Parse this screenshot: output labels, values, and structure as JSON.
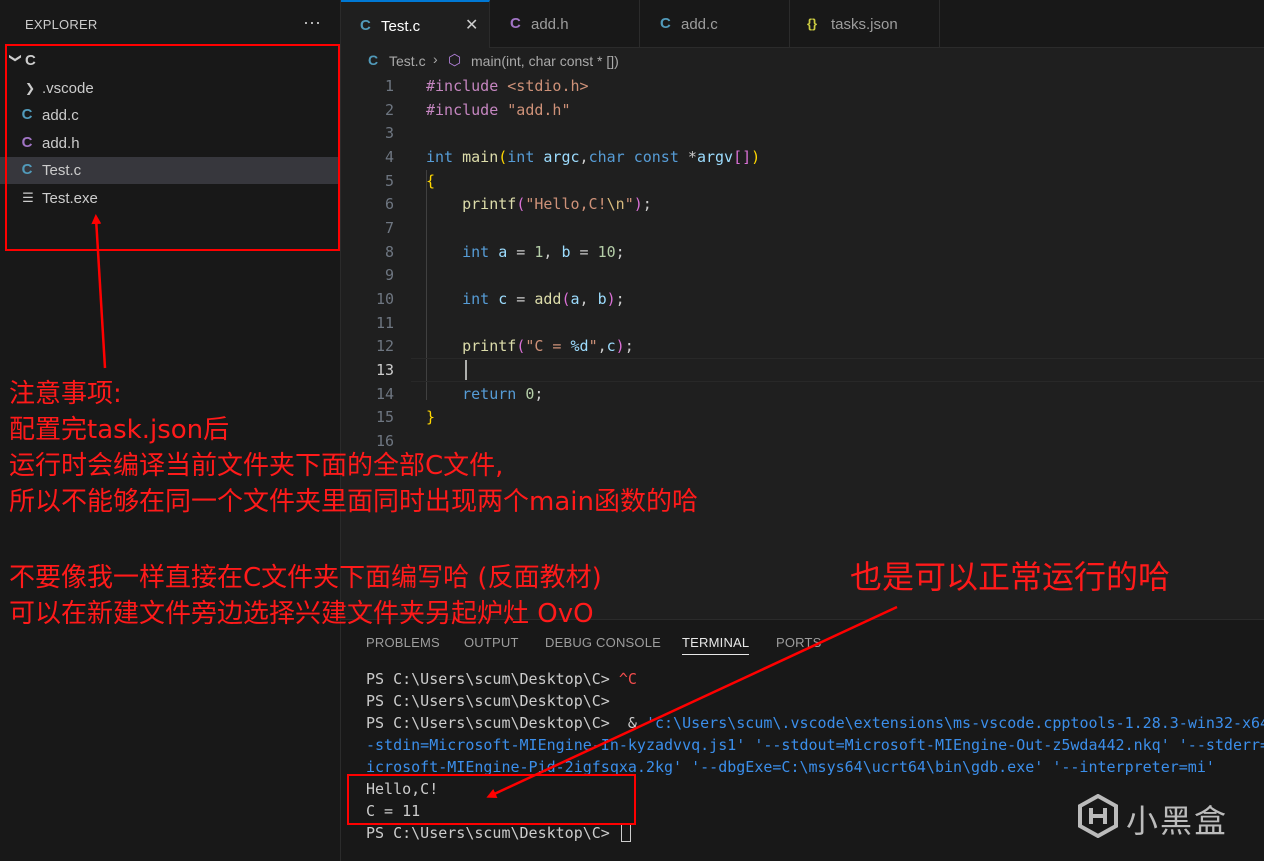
{
  "sidebar": {
    "title": "EXPLORER",
    "more_icon": "···",
    "folder": {
      "name": "C",
      "twisty": "❯"
    },
    "items": [
      {
        "type": "folder",
        "label": ".vscode",
        "icon": "❯"
      },
      {
        "type": "c",
        "label": "add.c",
        "icon": "C"
      },
      {
        "type": "h",
        "label": "add.h",
        "icon": "C"
      },
      {
        "type": "c",
        "label": "Test.c",
        "icon": "C",
        "selected": true
      },
      {
        "type": "exe",
        "label": "Test.exe",
        "icon": "☰"
      }
    ]
  },
  "tabs": [
    {
      "label": "Test.c",
      "icon": "C",
      "active": true,
      "close": "✕"
    },
    {
      "label": "add.h",
      "icon": "C"
    },
    {
      "label": "add.c",
      "icon": "C"
    },
    {
      "label": "tasks.json",
      "icon": "{}"
    }
  ],
  "breadcrumb": {
    "icon": "C",
    "file": "Test.c",
    "sep": "›",
    "symbol_icon": "⬡",
    "symbol": "main(int, char const * [])"
  },
  "editor": {
    "current_line": 13,
    "line_numbers": [
      "1",
      "2",
      "3",
      "4",
      "5",
      "6",
      "7",
      "8",
      "9",
      "10",
      "11",
      "12",
      "13",
      "14",
      "15",
      "16"
    ]
  },
  "panel": {
    "tabs": [
      "PROBLEMS",
      "OUTPUT",
      "DEBUG CONSOLE",
      "TERMINAL",
      "PORTS"
    ],
    "active_tab": "TERMINAL",
    "terminal": {
      "prompt": "PS C:\\Users\\scum\\Desktop\\C>",
      "ctrl_c": "^C",
      "amp": "&",
      "cmd_1": "'c:\\Users\\scum\\.vscode\\extensions\\ms-vscode.cpptools-1.28.3-win32-x64",
      "cmd_2": "-stdin=Microsoft-MIEngine-In-kyzadvvq.js1' '--stdout=Microsoft-MIEngine-Out-z5wda442.nkq' '--stderr=",
      "cmd_3": "icrosoft-MIEngine-Pid-2igfsqxa.2kg' '--dbgExe=C:\\msys64\\ucrt64\\bin\\gdb.exe' '--interpreter=mi'",
      "output_1": "Hello,C!",
      "output_2": "C = 11"
    }
  },
  "annotations": {
    "color": "#ff0000",
    "note_lines": [
      "注意事项:",
      "配置完task.json后",
      "运行时会编译当前文件夹下面的全部C文件,",
      "所以不能够在同一个文件夹里面同时出现两个main函数的哈"
    ],
    "tip_lines": [
      "不要像我一样直接在C文件夹下面编写哈   (反面教材)",
      "可以在新建文件旁边选择兴建文件夹另起炉灶     OvO"
    ],
    "runs_ok": "也是可以正常运行的哈"
  },
  "watermark": {
    "text": "小黑盒",
    "icon": "heybox-logo-icon"
  }
}
